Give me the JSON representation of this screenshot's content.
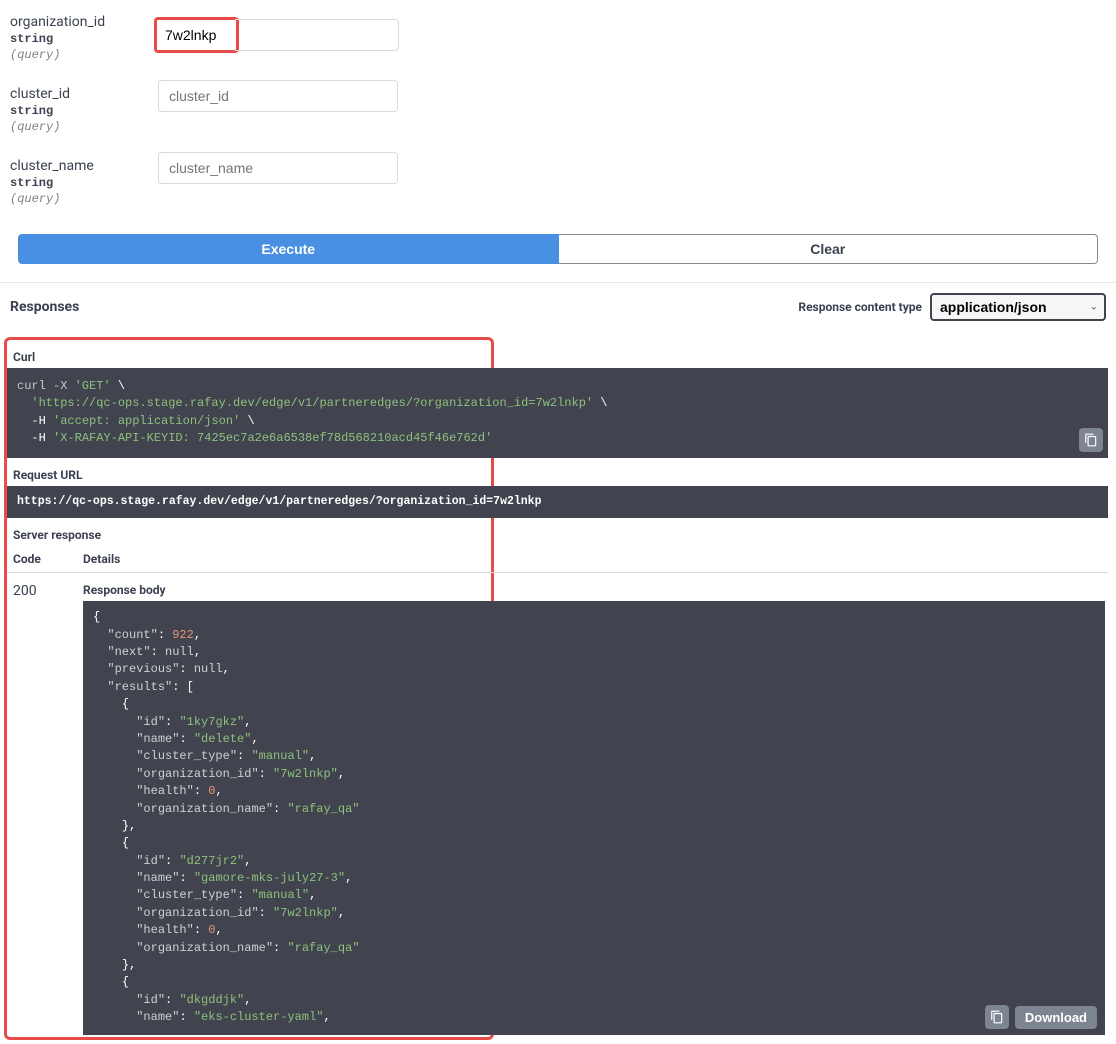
{
  "params": {
    "organization_id": {
      "name": "organization_id",
      "type": "string",
      "in": "(query)",
      "value": "7w2lnkp",
      "placeholder": "organization_id"
    },
    "cluster_id": {
      "name": "cluster_id",
      "type": "string",
      "in": "(query)",
      "value": "",
      "placeholder": "cluster_id"
    },
    "cluster_name": {
      "name": "cluster_name",
      "type": "string",
      "in": "(query)",
      "value": "",
      "placeholder": "cluster_name"
    }
  },
  "buttons": {
    "execute": "Execute",
    "clear": "Clear",
    "download": "Download"
  },
  "responses": {
    "title": "Responses",
    "content_type_label": "Response content type",
    "content_type_value": "application/json"
  },
  "curl": {
    "title": "Curl",
    "line1_pre": "curl -X ",
    "line1_method": "'GET'",
    "line1_post": " \\",
    "line2": "'https://qc-ops.stage.rafay.dev/edge/v1/partneredges/?organization_id=7w2lnkp'",
    "line2_post": " \\",
    "line3_pre": "  -H ",
    "line3": "'accept: application/json'",
    "line3_post": " \\",
    "line4_pre": "  -H ",
    "line4": "'X-RAFAY-API-KEYID: 7425ec7a2e6a6538ef78d568210acd45f46e762d'"
  },
  "request_url": {
    "title": "Request URL",
    "value": "https://qc-ops.stage.rafay.dev/edge/v1/partneredges/?organization_id=7w2lnkp"
  },
  "server_response": {
    "title": "Server response",
    "code_header": "Code",
    "details_header": "Details",
    "code": "200",
    "body_label": "Response body",
    "json": {
      "count": 922,
      "results": [
        {
          "id": "1ky7gkz",
          "name": "delete",
          "cluster_type": "manual",
          "organization_id": "7w2lnkp",
          "health": 0,
          "organization_name": "rafay_qa"
        },
        {
          "id": "d277jr2",
          "name": "gamore-mks-july27-3",
          "cluster_type": "manual",
          "organization_id": "7w2lnkp",
          "health": 0,
          "organization_name": "rafay_qa"
        },
        {
          "id": "dkgddjk",
          "name": "eks-cluster-yaml"
        }
      ]
    }
  }
}
